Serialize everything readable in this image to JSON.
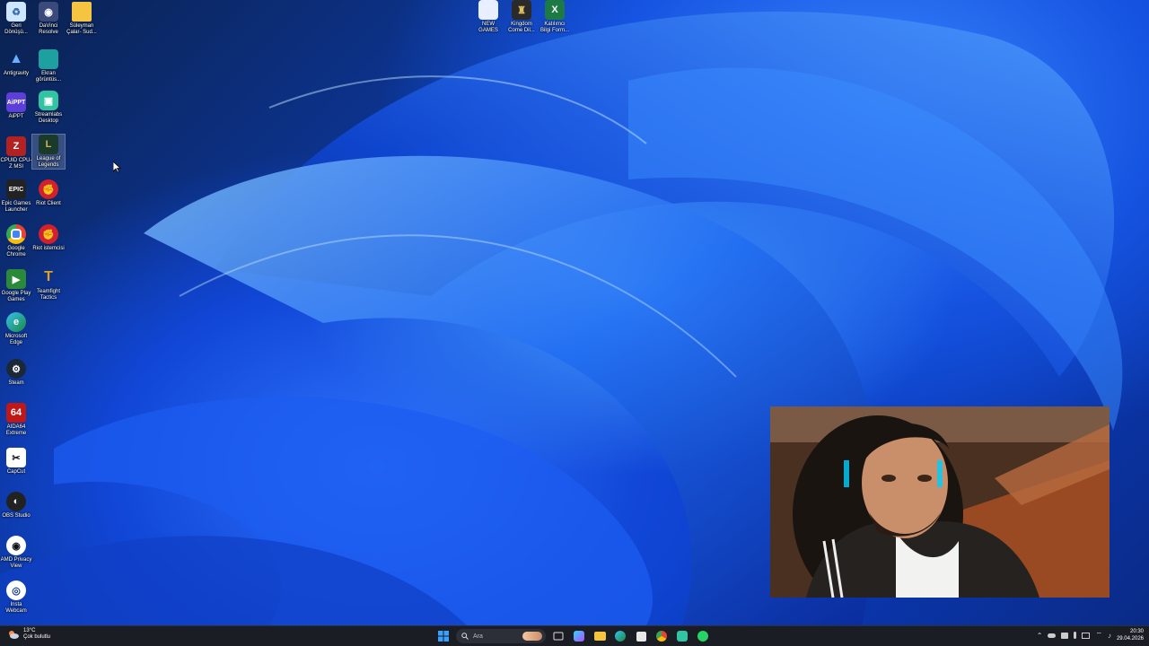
{
  "desktop_icons": [
    {
      "id": "geri",
      "label": "Geri Dönüşü...",
      "icon": "recycle-bin-icon",
      "color": "#cfe6ff"
    },
    {
      "id": "davinci",
      "label": "DaVinci Resolve",
      "icon": "davinci-icon",
      "color": "#3a4a7a"
    },
    {
      "id": "suleyman",
      "label": "Süleyman Çalar- Sud...",
      "icon": "folder-icon",
      "color": "#f5c542"
    },
    {
      "id": "antigravity",
      "label": "Antigravity",
      "icon": "antigravity-icon",
      "color": "#1b2a4a"
    },
    {
      "id": "ekran",
      "label": "Ekran görüntüs...",
      "icon": "screenshot-icon",
      "color": "#1fa0a0"
    },
    {
      "id": "aippt",
      "label": "AiPPT",
      "icon": "aippt-icon",
      "color": "#5b3fd8"
    },
    {
      "id": "streamlabs",
      "label": "Streamlabs Desktop",
      "icon": "streamlabs-icon",
      "color": "#31c3a2"
    },
    {
      "id": "cpuid",
      "label": "CPUID CPU-Z MSI",
      "icon": "cpuz-icon",
      "color": "#b22222"
    },
    {
      "id": "league",
      "label": "League of Legends",
      "icon": "league-icon",
      "color": "#1a3a2a"
    },
    {
      "id": "epic",
      "label": "Epic Games Launcher",
      "icon": "epic-icon",
      "color": "#222"
    },
    {
      "id": "riot",
      "label": "Riot Client",
      "icon": "riot-icon",
      "color": "#d3202e"
    },
    {
      "id": "chrome",
      "label": "Google Chrome",
      "icon": "chrome-icon",
      "color": "#fff"
    },
    {
      "id": "riot2",
      "label": "Riot istemcisi",
      "icon": "riot-icon",
      "color": "#d3202e"
    },
    {
      "id": "gplay",
      "label": "Google Play Games",
      "icon": "play-games-icon",
      "color": "#2a8a3a"
    },
    {
      "id": "tft",
      "label": "Teamfight Tactics",
      "icon": "tft-icon",
      "color": "#e0a020"
    },
    {
      "id": "edge",
      "label": "Microsoft Edge",
      "icon": "edge-icon",
      "color": "#1aa0c0"
    },
    {
      "id": "steam",
      "label": "Steam",
      "icon": "steam-icon",
      "color": "#1b2838"
    },
    {
      "id": "aida",
      "label": "AIDA64 Extreme",
      "icon": "aida64-icon",
      "color": "#c01818"
    },
    {
      "id": "capcut",
      "label": "CapCut",
      "icon": "capcut-icon",
      "color": "#111"
    },
    {
      "id": "obs",
      "label": "OBS Studio",
      "icon": "obs-icon",
      "color": "#222"
    },
    {
      "id": "amd",
      "label": "AMD Privacy View",
      "icon": "amd-privacy-icon",
      "color": "#111"
    },
    {
      "id": "insta360",
      "label": "Insta Webcam",
      "icon": "webcam-icon",
      "color": "#fff"
    },
    {
      "id": "newgames",
      "label": "NEW GAMES",
      "icon": "new-games-icon",
      "color": "#e8f0ff"
    },
    {
      "id": "kingdom",
      "label": "Kingdom Come Dil...",
      "icon": "kingdom-icon",
      "color": "#2a2a2a"
    },
    {
      "id": "katilimci",
      "label": "Katılımcı Bilgi Form...",
      "icon": "excel-icon",
      "color": "#1d7a45"
    }
  ],
  "taskbar": {
    "weather_temp": "13°C",
    "weather_desc": "Çok bulutlu",
    "search_placeholder": "Ara",
    "clock_time": "20:30",
    "clock_date": "29.04.2026"
  }
}
